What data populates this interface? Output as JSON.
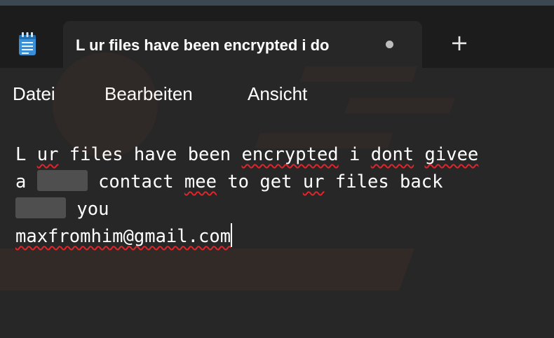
{
  "window": {
    "tab_title": "L ur files have been encrypted i do",
    "tab_unsaved_indicator": "●",
    "new_tab_label": "+"
  },
  "menu": {
    "items": [
      "Datei",
      "Bearbeiten",
      "Ansicht"
    ]
  },
  "editor": {
    "line1": "L ur files have been encrypted i dont givee",
    "line2_part1": "a",
    "line2_part2": "contact mee to get ur files back",
    "line3_part1": "you",
    "line4": "maxfromhim@gmail.com"
  },
  "colors": {
    "background": "#272727",
    "titlebar": "#1c1c1c",
    "spellcheck": "#e0242c",
    "text": "#ffffff"
  },
  "icons": {
    "app": "notepad-icon",
    "new_tab": "plus-icon",
    "unsaved": "dot-icon"
  }
}
